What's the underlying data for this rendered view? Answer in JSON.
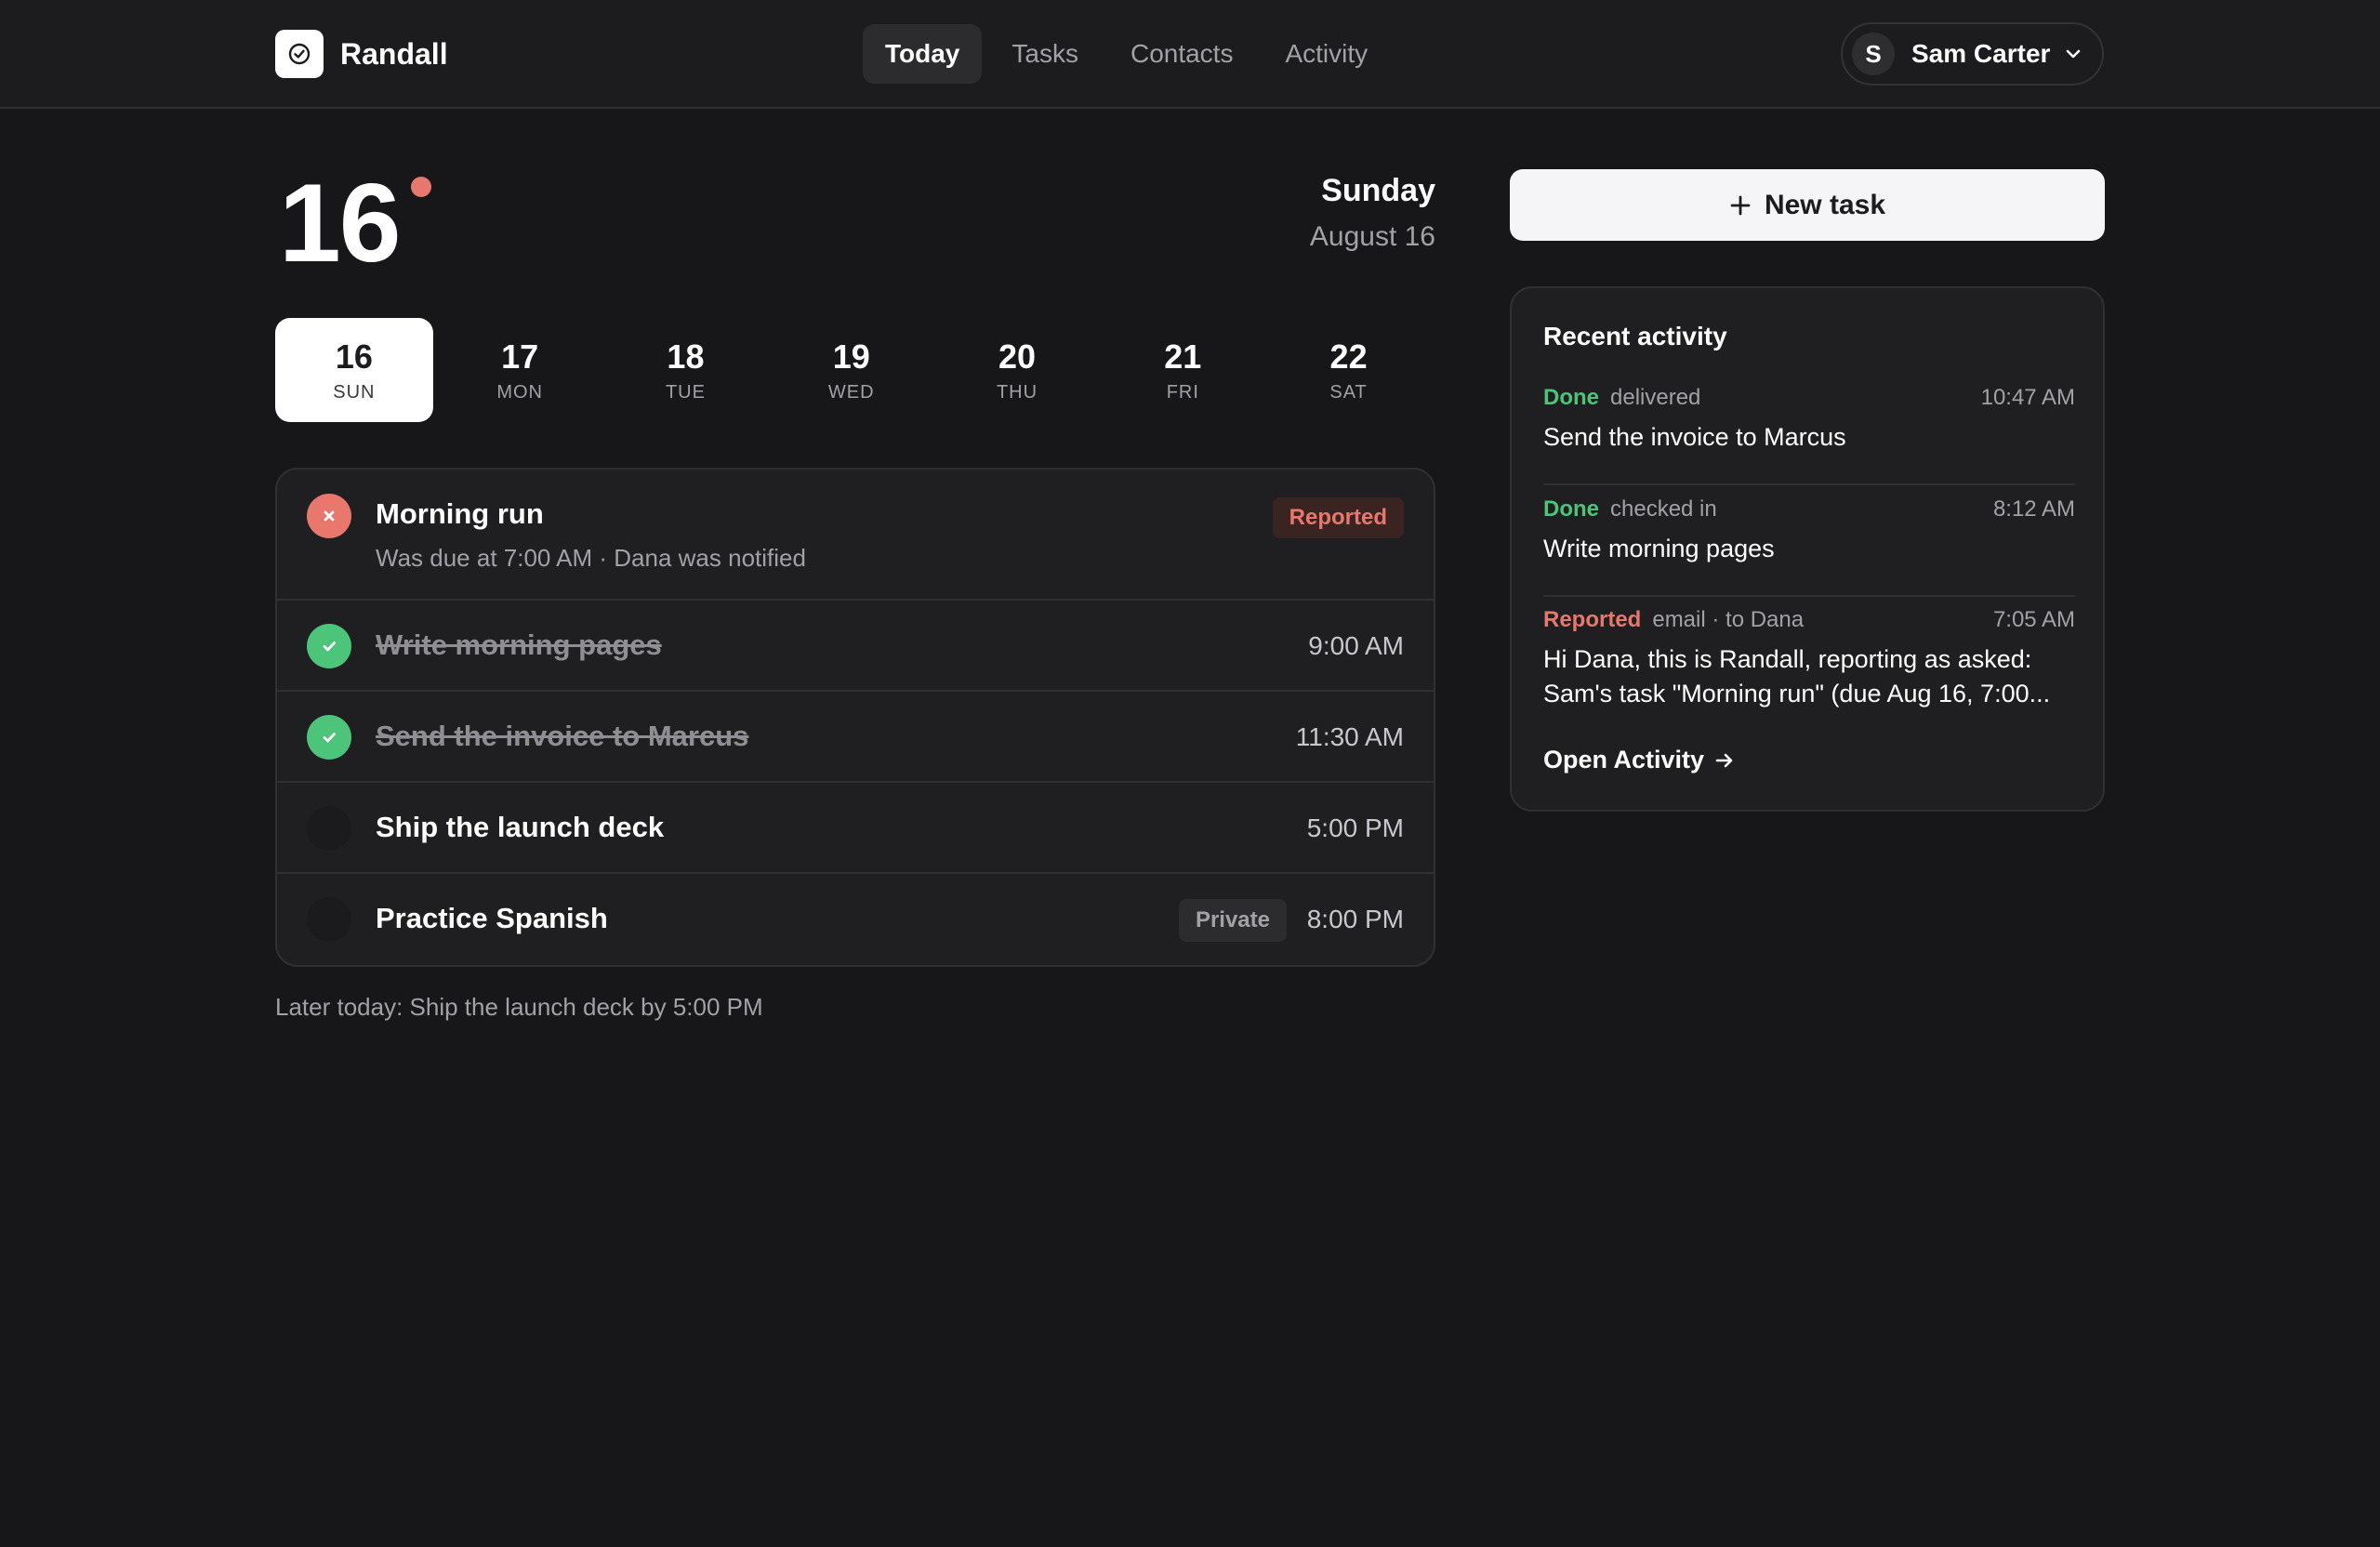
{
  "app": {
    "name": "Randall"
  },
  "nav": {
    "tabs": [
      {
        "label": "Today",
        "active": true
      },
      {
        "label": "Tasks",
        "active": false
      },
      {
        "label": "Contacts",
        "active": false
      },
      {
        "label": "Activity",
        "active": false
      }
    ]
  },
  "user": {
    "initial": "S",
    "name": "Sam Carter"
  },
  "today": {
    "day_number": "16",
    "weekday": "Sunday",
    "date": "August 16"
  },
  "week": [
    {
      "num": "16",
      "abbr": "SUN",
      "selected": true
    },
    {
      "num": "17",
      "abbr": "MON",
      "selected": false
    },
    {
      "num": "18",
      "abbr": "TUE",
      "selected": false
    },
    {
      "num": "19",
      "abbr": "WED",
      "selected": false
    },
    {
      "num": "20",
      "abbr": "THU",
      "selected": false
    },
    {
      "num": "21",
      "abbr": "FRI",
      "selected": false
    },
    {
      "num": "22",
      "abbr": "SAT",
      "selected": false
    }
  ],
  "tasks": [
    {
      "title": "Morning run",
      "status": "failed",
      "subtitle": "Was due at 7:00 AM · Dana was notified",
      "badge": "Reported"
    },
    {
      "title": "Write morning pages",
      "status": "done",
      "time": "9:00 AM"
    },
    {
      "title": "Send the invoice to Marcus",
      "status": "done",
      "time": "11:30 AM"
    },
    {
      "title": "Ship the launch deck",
      "status": "open",
      "time": "5:00 PM"
    },
    {
      "title": "Practice Spanish",
      "status": "open",
      "time": "8:00 PM",
      "badge": "Private"
    }
  ],
  "later_note": "Later today: Ship the launch deck by 5:00 PM",
  "new_task_label": "New task",
  "activity": {
    "title": "Recent activity",
    "items": [
      {
        "status": "Done",
        "verb": "delivered",
        "time": "10:47 AM",
        "body": [
          "Send the invoice to Marcus"
        ]
      },
      {
        "status": "Done",
        "verb": "checked in",
        "time": "8:12 AM",
        "body": [
          "Write morning pages"
        ]
      },
      {
        "status": "Reported",
        "verb": "email · to Dana",
        "time": "7:05 AM",
        "body": [
          "Hi Dana, this is Randall, reporting as asked:",
          "Sam's task \"Morning run\" (due Aug 16, 7:00..."
        ]
      }
    ],
    "open_label": "Open Activity"
  },
  "colors": {
    "background": "#171719",
    "done": "#4cc47a",
    "reported": "#e8776d"
  }
}
